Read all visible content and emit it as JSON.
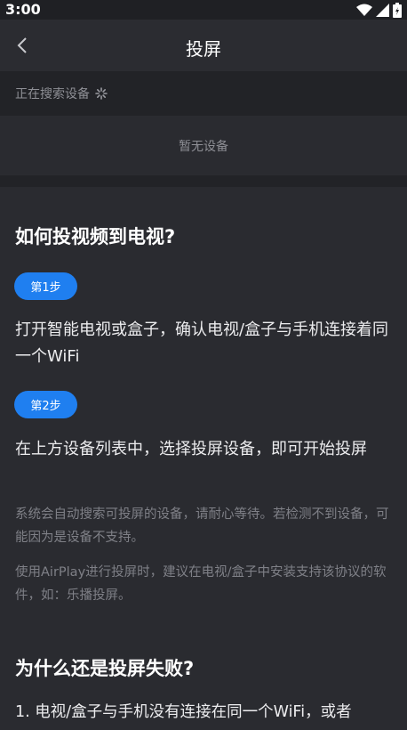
{
  "status_bar": {
    "time": "3:00",
    "icons": [
      "wifi-icon",
      "signal-icon",
      "battery-icon"
    ]
  },
  "navbar": {
    "back_icon": "chevron-left-icon",
    "title": "投屏"
  },
  "search": {
    "searching_label": "正在搜索设备",
    "spinner_icon": "loading-spinner-icon",
    "empty_label": "暂无设备"
  },
  "help": {
    "how_title": "如何投视频到电视?",
    "steps": [
      {
        "badge": "第1步",
        "text": "打开智能电视或盒子，确认电视/盒子与手机连接着同一个WiFi"
      },
      {
        "badge": "第2步",
        "text": "在上方设备列表中，选择投屏设备，即可开始投屏"
      }
    ],
    "notes": [
      "系统会自动搜索可投屏的设备，请耐心等待。若检测不到设备，可能因为是设备不支持。",
      "使用AirPlay进行投屏时，建议在电视/盒子中安装支持该协议的软件，如：乐播投屏。"
    ],
    "fail_title": "为什么还是投屏失败?",
    "reasons": [
      "1. 电视/盒子与手机没有连接在同一个WiFi，或者"
    ]
  },
  "colors": {
    "accent": "#1f7ff0",
    "background": "#2a2b30",
    "search_bg": "#222327"
  }
}
